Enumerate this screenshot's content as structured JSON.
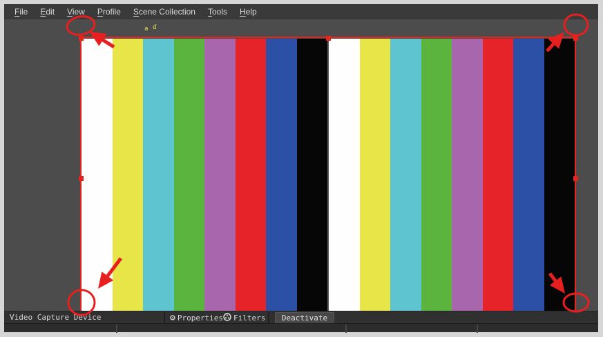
{
  "menu_bar": {
    "items": [
      {
        "first": "F",
        "rest": "ile"
      },
      {
        "first": "E",
        "rest": "dit"
      },
      {
        "first": "V",
        "rest": "iew"
      },
      {
        "first": "P",
        "rest": "rofile"
      },
      {
        "first": "S",
        "rest": "cene Collection"
      },
      {
        "first": "T",
        "rest": "ools"
      },
      {
        "first": "H",
        "rest": "elp"
      }
    ]
  },
  "preview": {
    "background": "#4c4c4c",
    "selection_color": "#e8231d",
    "test_pattern": {
      "type": "color-bars",
      "repeats": 2,
      "bar_names": [
        "white",
        "yellow",
        "cyan",
        "green",
        "magenta",
        "red",
        "blue",
        "black"
      ],
      "bar_colors": [
        "#fefefe",
        "#e8e549",
        "#5ec5d0",
        "#5bb43d",
        "#a867ac",
        "#e52329",
        "#2b50a6",
        "#060607"
      ]
    },
    "artifact_marks": [
      "a",
      "d"
    ]
  },
  "source_toolbar": {
    "source_name": "Video Capture Device",
    "properties_label": "Properties",
    "filters_label": "Filters",
    "deactivate_label": "Deactivate",
    "gear_glyph": "⚙"
  },
  "annotations": {
    "color": "#e81f1f"
  }
}
